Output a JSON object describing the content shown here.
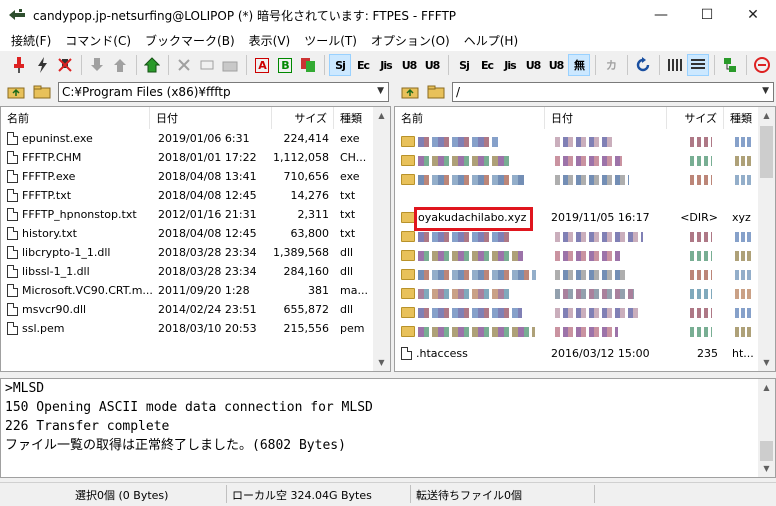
{
  "window": {
    "title": "candypop.jp-netsurfing@LOLIPOP (*) 暗号化されています: FTPES - FFFTP",
    "minimize": "—",
    "maximize": "☐",
    "close": "✕"
  },
  "menu": [
    "接続(F)",
    "コマンド(C)",
    "ブックマーク(B)",
    "表示(V)",
    "ツール(T)",
    "オプション(O)",
    "ヘルプ(H)"
  ],
  "toolbar": {
    "text_buttons": [
      "A",
      "B",
      "Sj",
      "Ec",
      "Jis",
      "U8",
      "U8",
      "Sj",
      "Ec",
      "Jis",
      "U8",
      "U8",
      "無",
      "カ"
    ]
  },
  "local": {
    "path": "C:¥Program Files (x86)¥ffftp",
    "headers": {
      "name": "名前",
      "date": "日付",
      "size": "サイズ",
      "type": "種類"
    },
    "files": [
      {
        "name": "epuninst.exe",
        "date": "2019/01/06  6:31",
        "size": "224,414",
        "type": "exe"
      },
      {
        "name": "FFFTP.CHM",
        "date": "2018/01/01 17:22",
        "size": "1,112,058",
        "type": "CH..."
      },
      {
        "name": "FFFTP.exe",
        "date": "2018/04/08 13:41",
        "size": "710,656",
        "type": "exe"
      },
      {
        "name": "FFFTP.txt",
        "date": "2018/04/08 12:45",
        "size": "14,276",
        "type": "txt"
      },
      {
        "name": "FFFTP_hpnonstop.txt",
        "date": "2012/01/16 21:31",
        "size": "2,311",
        "type": "txt"
      },
      {
        "name": "history.txt",
        "date": "2018/04/08 12:45",
        "size": "63,800",
        "type": "txt"
      },
      {
        "name": "libcrypto-1_1.dll",
        "date": "2018/03/28 23:34",
        "size": "1,389,568",
        "type": "dll"
      },
      {
        "name": "libssl-1_1.dll",
        "date": "2018/03/28 23:34",
        "size": "284,160",
        "type": "dll"
      },
      {
        "name": "Microsoft.VC90.CRT.m...",
        "date": "2011/09/20  1:28",
        "size": "381",
        "type": "ma..."
      },
      {
        "name": "msvcr90.dll",
        "date": "2014/02/24 23:51",
        "size": "655,872",
        "type": "dll"
      },
      {
        "name": "ssl.pem",
        "date": "2018/03/10 20:53",
        "size": "215,556",
        "type": "pem"
      }
    ]
  },
  "remote": {
    "path": "/",
    "headers": {
      "name": "名前",
      "date": "日付",
      "size": "サイズ",
      "type": "種類"
    },
    "highlighted": {
      "name": "oyakudachilabo.xyz",
      "date": "2019/11/05 16:17",
      "size": "<DIR>",
      "type": "xyz"
    },
    "last": {
      "name": ".htaccess",
      "date": "2016/03/12 15:00",
      "size": "235",
      "type": "ht..."
    }
  },
  "log": [
    ">MLSD",
    "150 Opening ASCII mode data connection for MLSD",
    "226 Transfer complete",
    "ファイル一覧の取得は正常終了しました。(6802 Bytes)"
  ],
  "status": {
    "selected": "選択0個 (0 Bytes)",
    "local_free": "ローカル空 324.04G Bytes",
    "queue": "転送待ちファイル0個"
  }
}
